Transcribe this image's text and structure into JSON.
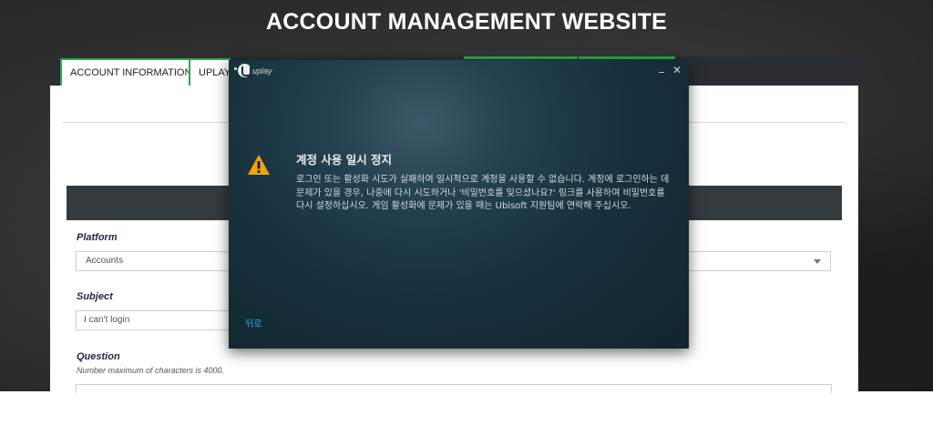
{
  "site": {
    "title": "ACCOUNT MANAGEMENT WEBSITE"
  },
  "tabs": [
    {
      "label": "ACCOUNT INFORMATION"
    },
    {
      "label": "UPLAY"
    }
  ],
  "form": {
    "platform": {
      "label": "Platform",
      "value": "Accounts"
    },
    "subject": {
      "label": "Subject",
      "value": "I can't login"
    },
    "question": {
      "label": "Question",
      "note": "Number maximum of characters is 4000."
    }
  },
  "dialog": {
    "app_name": "uplay",
    "minimize_glyph": "_",
    "close_glyph": "✕",
    "title": "계정 사용 일시 정지",
    "body": "로그인 또는 활성화 시도가 실패하여 일시적으로 계정을 사용할 수 없습니다. 계정에 로그인하는 데 문제가 있을 경우, 나중에 다시 시도하거나 '비밀번호를 잊으셨나요?' 링크를 사용하여 비밀번호를 다시 설정하십시오. 게임 활성화에 문제가 있을 때는 Ubisoft 지원팀에 연락해 주십시오.",
    "back_label": "뒤로",
    "warning_color": "#f0a30a",
    "link_color": "#29a3e0"
  },
  "colors": {
    "accent": "#2fa84f",
    "tabbar": "#2a2e33",
    "band": "#353a3f"
  }
}
